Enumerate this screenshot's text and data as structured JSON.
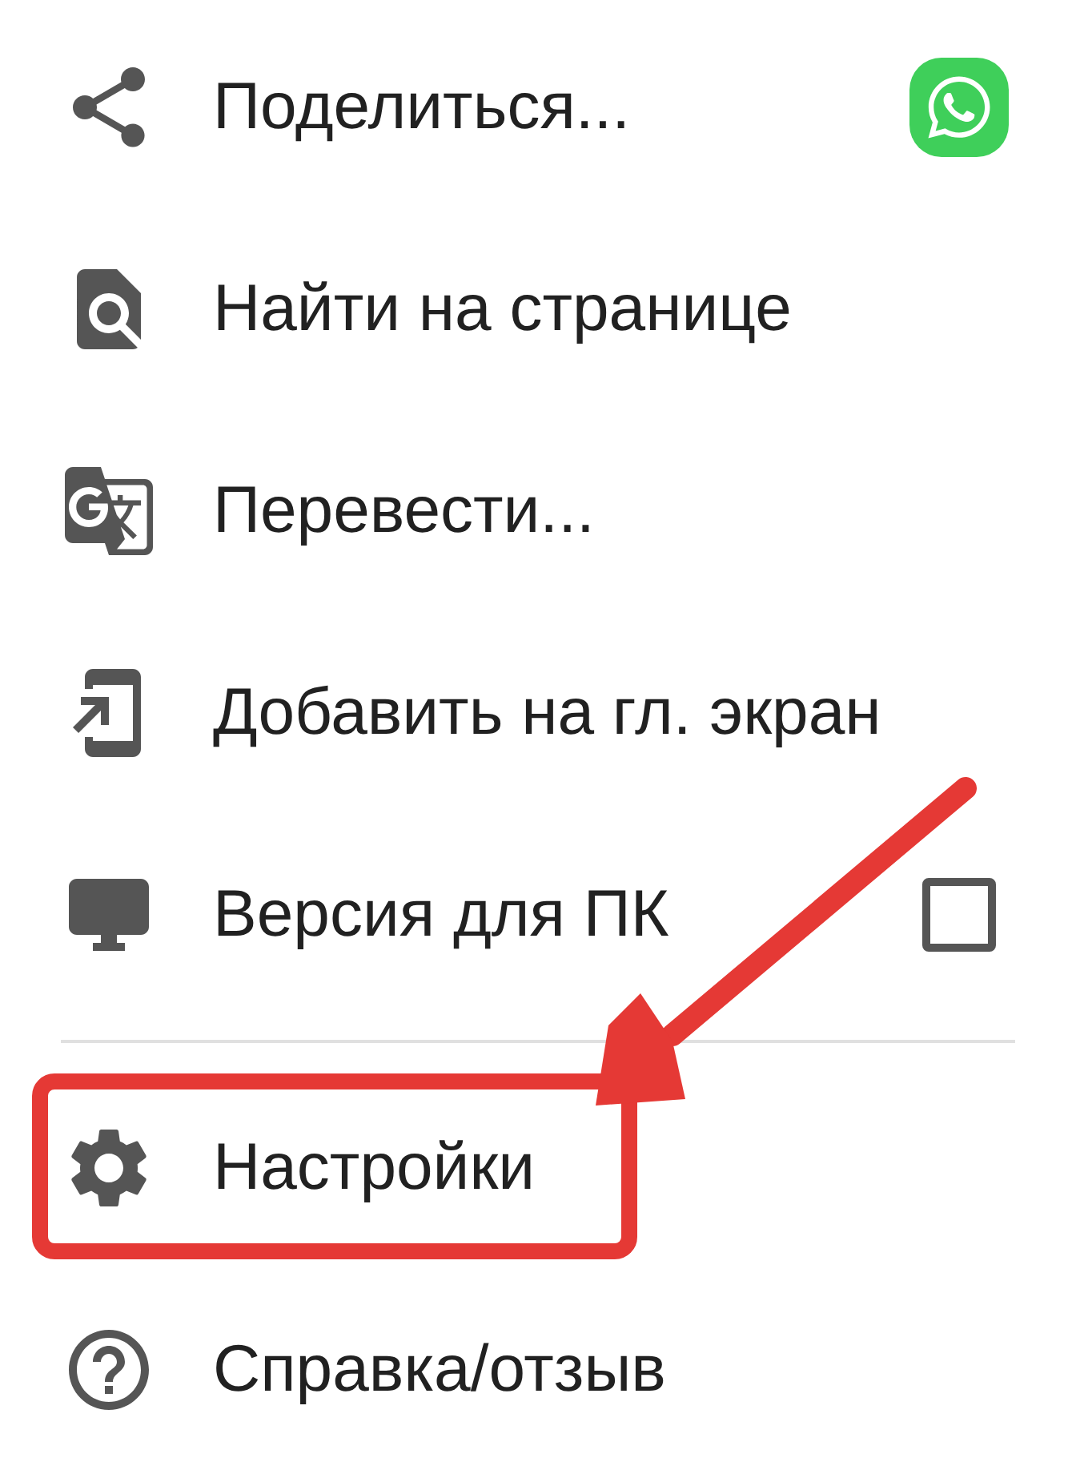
{
  "menu": {
    "items": [
      {
        "label": "Поделиться...",
        "kind": "share",
        "highlighted": false
      },
      {
        "label": "Найти на странице",
        "kind": "plain",
        "highlighted": false
      },
      {
        "label": "Перевести...",
        "kind": "plain",
        "highlighted": false
      },
      {
        "label": "Добавить на гл. экран",
        "kind": "plain",
        "highlighted": false
      },
      {
        "label": "Версия для ПК",
        "kind": "checkbox",
        "checked": false,
        "highlighted": false
      },
      {
        "label": "Настройки",
        "kind": "plain",
        "highlighted": true,
        "divider_before": true
      },
      {
        "label": "Справка/отзыв",
        "kind": "plain",
        "highlighted": false
      }
    ]
  }
}
